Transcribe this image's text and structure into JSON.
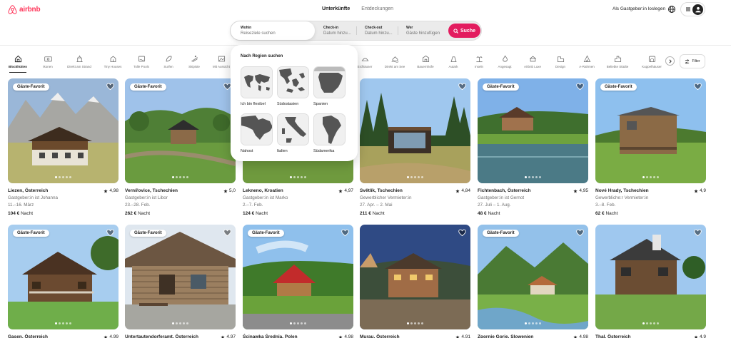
{
  "brand": {
    "name": "airbnb",
    "color": "#ff385c"
  },
  "top_tabs": [
    {
      "label": "Unterkünfte",
      "active": true
    },
    {
      "label": "Entdeckungen",
      "active": false
    }
  ],
  "header": {
    "host_link": "Als Gastgeber:in loslegen"
  },
  "search": {
    "where_label": "Wohin",
    "where_placeholder": "Reiseziele suchen",
    "checkin_label": "Check-in",
    "checkin_value": "Datum hinzu...",
    "checkout_label": "Check-out",
    "checkout_value": "Datum hinzu...",
    "who_label": "Wer",
    "who_value": "Gäste hinzufügen",
    "button_label": "Suche",
    "button_color": "#e31c5f"
  },
  "categories": [
    {
      "label": "Blockhütten",
      "icon": "cabin-icon",
      "active": true
    },
    {
      "label": "Ikonen",
      "icon": "ticket-icon",
      "active": false
    },
    {
      "label": "Direkt am Strand",
      "icon": "beach-icon",
      "active": false
    },
    {
      "label": "Tiny Houses",
      "icon": "tiny-house-icon",
      "active": false
    },
    {
      "label": "Tolle Pools",
      "icon": "pool-icon",
      "active": false
    },
    {
      "label": "Surfen",
      "icon": "surf-icon",
      "active": false
    },
    {
      "label": "Skipiste",
      "icon": "ski-icon",
      "active": false
    },
    {
      "label": "Mit Aussicht",
      "icon": "view-icon",
      "active": false
    },
    {
      "label": "Erdhäuser",
      "icon": "earth-house-icon",
      "active": false
    },
    {
      "label": "Direkt am See",
      "icon": "lake-icon",
      "active": false
    },
    {
      "label": "Bauernhöfe",
      "icon": "farm-icon",
      "active": false
    },
    {
      "label": "Autark",
      "icon": "off-grid-icon",
      "active": false
    },
    {
      "label": "Inseln",
      "icon": "island-icon",
      "active": false
    },
    {
      "label": "Angesagt",
      "icon": "trending-icon",
      "active": false
    },
    {
      "label": "Airbnb Luxe",
      "icon": "luxe-icon",
      "active": false
    },
    {
      "label": "Design",
      "icon": "design-icon",
      "active": false
    },
    {
      "label": "A-Rahmen",
      "icon": "a-frame-icon",
      "active": false
    },
    {
      "label": "Beliebte Städte",
      "icon": "city-icon",
      "active": false
    },
    {
      "label": "Kuppelhäuser",
      "icon": "dome-icon",
      "active": false
    }
  ],
  "filter_label": "Filter",
  "region_popup": {
    "title": "Nach Region suchen",
    "regions": [
      {
        "label": "Ich bin flexibel",
        "map": "world"
      },
      {
        "label": "Südostasien",
        "map": "southeast-asia"
      },
      {
        "label": "Spanien",
        "map": "spain"
      },
      {
        "label": "Nahost",
        "map": "middle-east"
      },
      {
        "label": "Italien",
        "map": "italy"
      },
      {
        "label": "Südamerika",
        "map": "south-america"
      }
    ]
  },
  "listings": [
    {
      "location": "Liezen, Österreich",
      "rating": "4,98",
      "host": "Gastgeber:in ist Johanna",
      "dates": "11.–16. März",
      "price": "104 €",
      "price_unit": "Nacht",
      "badge": "Gäste-Favorit",
      "scene": "alpine"
    },
    {
      "location": "Vernířovice, Tschechien",
      "rating": "5,0",
      "host": "Gastgeber:in ist Libor",
      "dates": "23.–28. Feb.",
      "price": "262 €",
      "price_unit": "Nacht",
      "badge": "Gäste-Favorit",
      "scene": "garden"
    },
    {
      "location": "Lekneno, Kroatien",
      "rating": "4,97",
      "host": "Gastgeber:in ist Marko",
      "dates": "2.–7. Feb.",
      "price": "124 €",
      "price_unit": "Nacht",
      "badge": "",
      "scene": "cabin"
    },
    {
      "location": "Světlík, Tschechien",
      "rating": "4,84",
      "host": "Gewerblicher Vermieter:in",
      "dates": "27. Apr. – 2. Mai",
      "price": "211 €",
      "price_unit": "Nacht",
      "badge": "",
      "scene": "forest"
    },
    {
      "location": "Fichtenbach, Österreich",
      "rating": "4,95",
      "host": "Gastgeber:in ist Gernot",
      "dates": "27. Juli – 1. Aug.",
      "price": "48 €",
      "price_unit": "Nacht",
      "badge": "Gäste-Favorit",
      "scene": "lake"
    },
    {
      "location": "Nové Hrady, Tschechien",
      "rating": "4,9",
      "host": "Gewerbliche:r Vermieter:in",
      "dates": "3.–8. Feb.",
      "price": "62 €",
      "price_unit": "Nacht",
      "badge": "Gäste-Favorit",
      "scene": "shed"
    },
    {
      "location": "Gasen, Österreich",
      "rating": "4,99",
      "host": "",
      "dates": "",
      "price": "",
      "price_unit": "",
      "badge": "Gäste-Favorit",
      "scene": "chalet"
    },
    {
      "location": "Untertautendorferamt, Österreich",
      "rating": "4,97",
      "host": "",
      "dates": "",
      "price": "",
      "price_unit": "",
      "badge": "Gäste-Favorit",
      "scene": "log"
    },
    {
      "location": "Ścinawka Średnia, Polen",
      "rating": "4,98",
      "host": "",
      "dates": "",
      "price": "",
      "price_unit": "",
      "badge": "Gäste-Favorit",
      "scene": "redroof"
    },
    {
      "location": "Murau, Österreich",
      "rating": "4,91",
      "host": "",
      "dates": "",
      "price": "",
      "price_unit": "",
      "badge": "",
      "scene": "dusk"
    },
    {
      "location": "Zgornje Gorje, Slowenien",
      "rating": "4,98",
      "host": "",
      "dates": "",
      "price": "",
      "price_unit": "",
      "badge": "Gäste-Favorit",
      "scene": "valley"
    },
    {
      "location": "Thal, Österreich",
      "rating": "4,9",
      "host": "",
      "dates": "",
      "price": "",
      "price_unit": "",
      "badge": "",
      "scene": "tower"
    }
  ]
}
